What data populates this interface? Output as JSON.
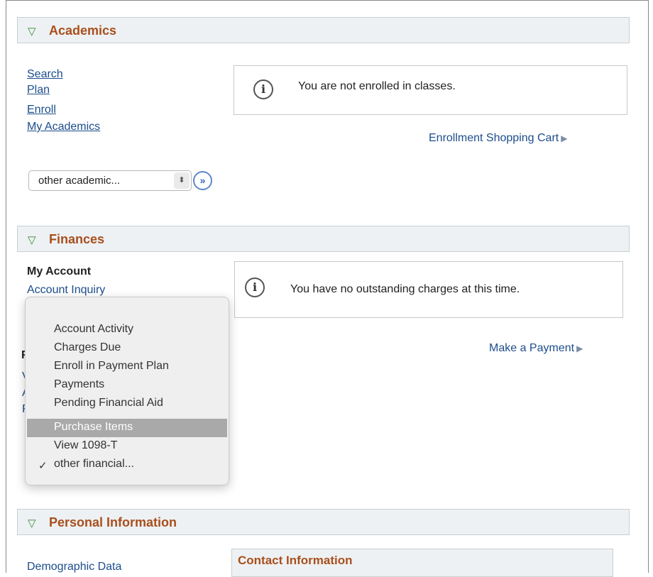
{
  "academics": {
    "title": "Academics",
    "links": [
      "Search",
      "Plan",
      "Enroll",
      "My Academics"
    ],
    "message": "You are not enrolled in classes.",
    "cart_link": "Enrollment Shopping Cart",
    "select_value": "other academic...",
    "go_label": "»"
  },
  "finances": {
    "title": "Finances",
    "my_account_label": "My Account",
    "account_inquiry_link": "Account Inquiry",
    "message": "You have no outstanding charges at this time.",
    "payment_link": "Make a Payment",
    "dropdown": {
      "items": [
        "Account Activity",
        "Charges Due",
        "Enroll in Payment Plan",
        "Payments",
        "Pending Financial Aid",
        "Purchase Items",
        "View 1098-T",
        "other financial..."
      ],
      "highlighted": "Purchase Items",
      "checked": "other financial...",
      "check_mark": "✓"
    },
    "partial_chars": [
      "F",
      "V",
      "A",
      "F"
    ]
  },
  "personal": {
    "title": "Personal Information",
    "demographic_link": "Demographic Data",
    "contact_title": "Contact Information"
  },
  "icons": {
    "triangle": "▽",
    "info": "i",
    "play_arrow": "▶",
    "stepper": "⬍"
  },
  "colors": {
    "header_text": "#a84f1c",
    "link": "#1c4d8c",
    "header_bg": "#eef1f3",
    "highlight": "#a9a9a9"
  }
}
